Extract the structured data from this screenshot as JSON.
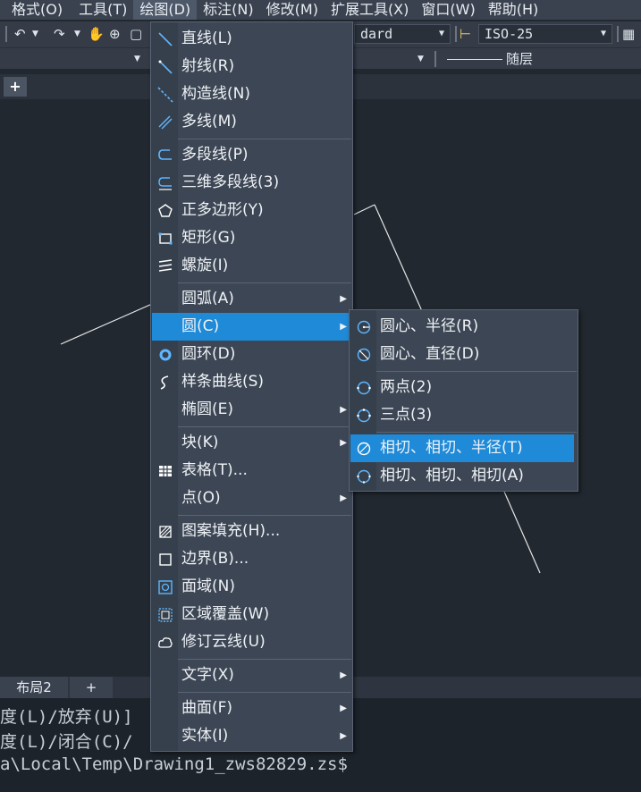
{
  "menubar": [
    "格式(O)",
    "工具(T)",
    "绘图(D)",
    "标注(N)",
    "修改(M)",
    "扩展工具(X)",
    "窗口(W)",
    "帮助(H)"
  ],
  "toolbar": {
    "text_style_value": "dard",
    "dim_style_value": "ISO-25",
    "linetype_label": "随层"
  },
  "layout_tabs": {
    "layout2": "布局2",
    "add": "+"
  },
  "command_lines": [
    "度(L)/放弃(U)]",
    "度(L)/闭合(C)/",
    "a\\Local\\Temp\\Drawing1_zws82829.zs$"
  ],
  "draw_menu": {
    "items": [
      {
        "label": "直线(L)",
        "icon": "line-icon"
      },
      {
        "label": "射线(R)",
        "icon": "ray-icon"
      },
      {
        "label": "构造线(N)",
        "icon": "xline-icon"
      },
      {
        "label": "多线(M)",
        "icon": "multiline-icon"
      },
      {
        "label": "多段线(P)",
        "icon": "polyline-icon"
      },
      {
        "label": "三维多段线(3)",
        "icon": "3d-polyline-icon"
      },
      {
        "label": "正多边形(Y)",
        "icon": "polygon-icon"
      },
      {
        "label": "矩形(G)",
        "icon": "rectangle-icon"
      },
      {
        "label": "螺旋(I)",
        "icon": "helix-icon"
      },
      {
        "label": "圆弧(A)",
        "icon": ""
      },
      {
        "label": "圆(C)",
        "icon": ""
      },
      {
        "label": "圆环(D)",
        "icon": "donut-icon"
      },
      {
        "label": "样条曲线(S)",
        "icon": "spline-icon"
      },
      {
        "label": "椭圆(E)",
        "icon": ""
      },
      {
        "label": "块(K)",
        "icon": ""
      },
      {
        "label": "表格(T)...",
        "icon": "table-icon"
      },
      {
        "label": "点(O)",
        "icon": ""
      },
      {
        "label": "图案填充(H)...",
        "icon": "hatch-icon"
      },
      {
        "label": "边界(B)...",
        "icon": "boundary-icon"
      },
      {
        "label": "面域(N)",
        "icon": "region-icon"
      },
      {
        "label": "区域覆盖(W)",
        "icon": "wipeout-icon"
      },
      {
        "label": "修订云线(U)",
        "icon": "revcloud-icon"
      },
      {
        "label": "文字(X)",
        "icon": ""
      },
      {
        "label": "曲面(F)",
        "icon": ""
      },
      {
        "label": "实体(I)",
        "icon": ""
      }
    ]
  },
  "circle_submenu": {
    "items": [
      {
        "label": "圆心、半径(R)",
        "icon": "circle-center-radius-icon"
      },
      {
        "label": "圆心、直径(D)",
        "icon": "circle-center-diameter-icon"
      },
      {
        "label": "两点(2)",
        "icon": "circle-2p-icon"
      },
      {
        "label": "三点(3)",
        "icon": "circle-3p-icon"
      },
      {
        "label": "相切、相切、半径(T)",
        "icon": "circle-ttr-icon"
      },
      {
        "label": "相切、相切、相切(A)",
        "icon": "circle-ttt-icon"
      }
    ]
  }
}
